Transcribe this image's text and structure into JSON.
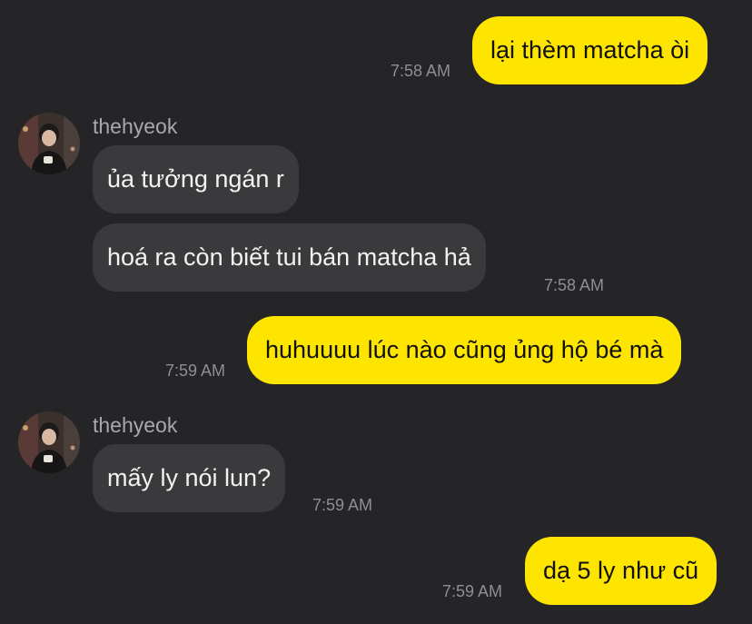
{
  "conversation": {
    "contact_name": "thehyeok",
    "messages": [
      {
        "direction": "outgoing",
        "text": "lại thèm matcha òi",
        "time": "7:58 AM"
      },
      {
        "direction": "incoming",
        "text": "ủa tưởng ngán r",
        "time": ""
      },
      {
        "direction": "incoming",
        "text": "hoá ra còn biết tui bán matcha hả",
        "time": "7:58 AM"
      },
      {
        "direction": "outgoing",
        "text": "huhuuuu lúc nào cũng ủng hộ bé mà",
        "time": "7:59 AM"
      },
      {
        "direction": "incoming",
        "text": "mấy ly nói lun?",
        "time": "7:59 AM"
      },
      {
        "direction": "outgoing",
        "text": "dạ 5 ly như cũ",
        "time": "7:59 AM"
      }
    ]
  },
  "colors": {
    "background": "#252527",
    "outgoing_bubble": "#fee500",
    "incoming_bubble": "#3a3a3d",
    "timestamp": "#8e8e93"
  }
}
